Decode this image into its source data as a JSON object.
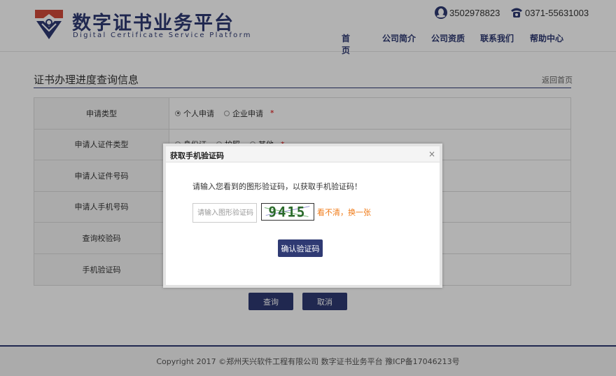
{
  "header": {
    "logo_title": "数字证书业务平台",
    "logo_subtitle": "Digital Certificate Service Platform",
    "contact_qq": "3502978823",
    "contact_tel": "0371-55631003",
    "nav": [
      "首页",
      "公司简介",
      "公司资质",
      "联系我们",
      "帮助中心"
    ]
  },
  "main": {
    "section_title": "证书办理进度查询信息",
    "back_link": "返回首页",
    "rows": [
      {
        "label": "申请类型",
        "options": [
          "个人申请",
          "企业申请"
        ],
        "required": "*"
      },
      {
        "label": "申请人证件类型",
        "options": [
          "身份证",
          "护照",
          "其他"
        ],
        "required": "*"
      },
      {
        "label": "申请人证件号码"
      },
      {
        "label": "申请人手机号码"
      },
      {
        "label": "查询校验码"
      },
      {
        "label": "手机验证码"
      }
    ],
    "query_button": "查询",
    "cancel_button": "取消"
  },
  "footer": {
    "text": "Copyright 2017 ©郑州天兴软件工程有限公司 数字证书业务平台 豫ICP备17046213号"
  },
  "modal": {
    "title": "获取手机验证码",
    "close": "×",
    "tip": "请输入您看到的图形验证码，以获取手机验证码！",
    "input_placeholder": "请输入图形验证码",
    "captcha_text": "9415",
    "refresh_link": "看不清，换一张",
    "confirm_button": "确认验证码"
  },
  "colors": {
    "brand": "#2f3a73",
    "accent_orange": "#f07a16",
    "required_red": "#dd0000"
  }
}
